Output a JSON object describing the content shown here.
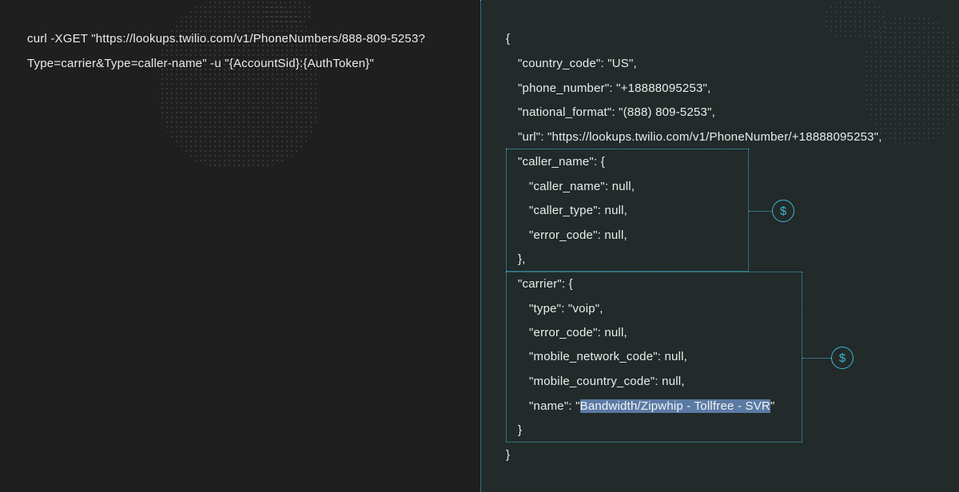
{
  "request": {
    "line1": "curl -XGET \"https://lookups.twilio.com/v1/PhoneNumbers/888-809-5253?",
    "line2": "Type=carrier&Type=caller-name\" -u \"{AccountSid}:{AuthToken}\""
  },
  "response": {
    "open_brace": "{",
    "country_code": "\"country_code\": \"US\",",
    "phone_number": "\"phone_number\": \"+18888095253\",",
    "national_format": "\"national_format\": \"(888) 809-5253\",",
    "url": "\"url\": \"https://lookups.twilio.com/v1/PhoneNumber/+18888095253\",",
    "caller_name_open": "\"caller_name\": {",
    "caller_name_value": "\"caller_name\": null,",
    "caller_type": "\"caller_type\": null,",
    "caller_error_code": "\"error_code\": null,",
    "caller_name_close": "},",
    "carrier_open": "\"carrier\": {",
    "carrier_type": "\"type\": \"voip\",",
    "carrier_error_code": "\"error_code\": null,",
    "mobile_network_code": "\"mobile_network_code\": null,",
    "mobile_country_code": "\"mobile_country_code\": null,",
    "carrier_name_key": "\"name\": \"",
    "carrier_name_value": "Bandwidth/Zipwhip - Tollfree - SVR",
    "carrier_name_end": "\"",
    "carrier_close": "}",
    "close_brace": "}"
  },
  "badges": {
    "caller_name_cost": "$",
    "carrier_cost": "$"
  },
  "icons": {
    "cost": "dollar-circle-icon"
  },
  "colors": {
    "accent": "#3fb7d0",
    "left_bg": "#1f1f1f",
    "right_bg": "#222a2a",
    "selection": "#5b7aa3"
  }
}
